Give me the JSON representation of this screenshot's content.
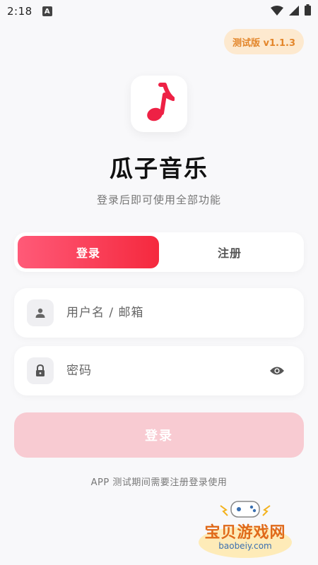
{
  "status_bar": {
    "time": "2:18",
    "notification_letter": "A"
  },
  "version_badge": "测试版 v1.1.3",
  "app": {
    "title": "瓜子音乐",
    "subtitle": "登录后即可使用全部功能",
    "accent_color": "#f5293e"
  },
  "tabs": [
    {
      "label": "登录",
      "active": true
    },
    {
      "label": "注册",
      "active": false
    }
  ],
  "form": {
    "username_placeholder": "用户名 / 邮箱",
    "password_placeholder": "密码",
    "submit_label": "登录"
  },
  "footer_note": "APP 测试期间需要注册登录使用",
  "watermark": {
    "name": "宝贝游戏网",
    "url": "baobeiy.com"
  }
}
